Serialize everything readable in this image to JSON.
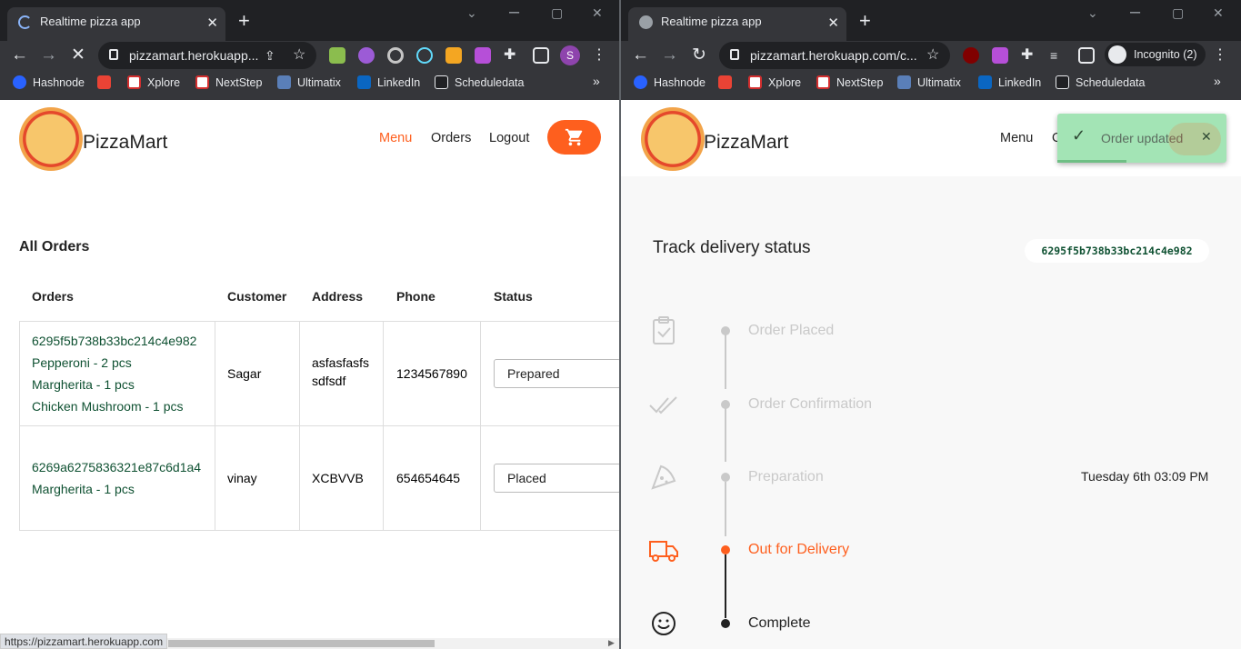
{
  "left": {
    "tab_title": "Realtime pizza app",
    "url": "pizzamart.herokuapp...",
    "profile_initial": "S",
    "bookmarks": [
      "Hashnode",
      "Xplore",
      "NextStep",
      "Ultimatix",
      "LinkedIn",
      "Scheduledata"
    ],
    "brand": "PizzaMart",
    "nav": {
      "menu": "Menu",
      "orders": "Orders",
      "logout": "Logout"
    },
    "heading": "All Orders",
    "columns": [
      "Orders",
      "Customer",
      "Address",
      "Phone",
      "Status"
    ],
    "rows": [
      {
        "order_id": "6295f5b738b33bc214c4e982",
        "items": [
          "Pepperoni - 2 pcs",
          "Margherita - 1 pcs",
          "Chicken Mushroom - 1 pcs"
        ],
        "customer": "Sagar",
        "address_lines": [
          "asfasfasfs",
          "sdfsdf"
        ],
        "phone": "1234567890",
        "status": "Prepared"
      },
      {
        "order_id": "6269a6275836321e87c6d1a4",
        "items": [
          "Margherita - 1 pcs"
        ],
        "customer": "vinay",
        "address_lines": [
          "XCBVVB"
        ],
        "phone": "654654645",
        "status": "Placed"
      }
    ],
    "status_url": "https://pizzamart.herokuapp.com"
  },
  "right": {
    "tab_title": "Realtime pizza app",
    "url": "pizzamart.herokuapp.com/c...",
    "incognito": "Incognito (2)",
    "bookmarks": [
      "Hashnode",
      "Xplore",
      "NextStep",
      "Ultimatix",
      "LinkedIn",
      "Scheduledata"
    ],
    "brand": "PizzaMart",
    "nav": {
      "menu": "Menu",
      "orders": "Orders"
    },
    "toast": "Order updated",
    "heading": "Track delivery status",
    "order_id": "6295f5b738b33bc214c4e982",
    "steps": [
      {
        "label": "Order Placed",
        "state": "done"
      },
      {
        "label": "Order Confirmation",
        "state": "done"
      },
      {
        "label": "Preparation",
        "state": "done",
        "time": "Tuesday 6th 03:09 PM"
      },
      {
        "label": "Out for Delivery",
        "state": "current"
      },
      {
        "label": "Complete",
        "state": "pending"
      }
    ]
  },
  "colors": {
    "accent": "#fe5f1e",
    "order_green": "#0f5132",
    "done_grey": "#c9c9c9",
    "toast_bg": "#a3e4b5"
  }
}
